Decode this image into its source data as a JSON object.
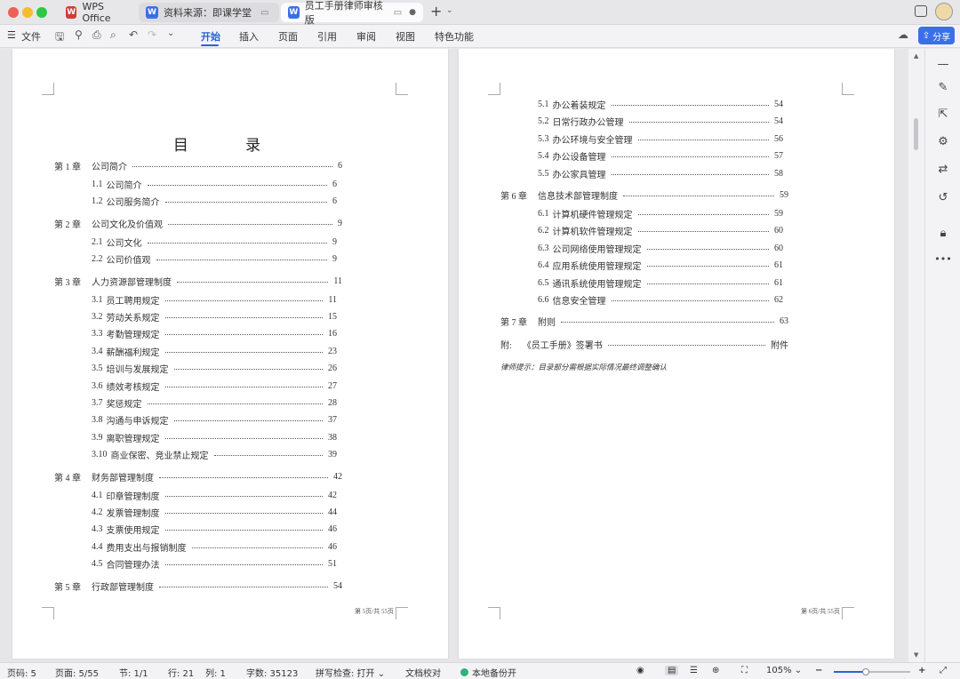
{
  "window": {
    "tabs": [
      {
        "label": "WPS Office",
        "icon": "wps-logo-icon"
      },
      {
        "label": "资料来源：即课学堂",
        "icon": "word-doc-icon"
      },
      {
        "label": "员工手册律师审核版",
        "icon": "word-doc-icon",
        "active": true
      }
    ],
    "icon_glyph_w": "W",
    "new_tab_glyph": "+"
  },
  "menubar": {
    "file": "文件",
    "tabs": [
      "开始",
      "插入",
      "页面",
      "引用",
      "审阅",
      "视图",
      "特色功能"
    ],
    "active_tab": "开始",
    "share": "分享"
  },
  "document": {
    "toc_title": "目 录",
    "left_page": {
      "entries": [
        {
          "num": "第 1 章",
          "title": "公司简介",
          "page": "6",
          "level": 1
        },
        {
          "num": "1.1",
          "title": "公司简介",
          "page": "6",
          "level": 2
        },
        {
          "num": "1.2",
          "title": "公司服务简介",
          "page": "6",
          "level": 2
        },
        {
          "num": "第 2 章",
          "title": "公司文化及价值观",
          "page": "9",
          "level": 1
        },
        {
          "num": "2.1",
          "title": "公司文化",
          "page": "9",
          "level": 2
        },
        {
          "num": "2.2",
          "title": "公司价值观",
          "page": "9",
          "level": 2
        },
        {
          "num": "第 3 章",
          "title": "人力资源部管理制度",
          "page": "11",
          "level": 1
        },
        {
          "num": "3.1",
          "title": "员工聘用规定",
          "page": "11",
          "level": 2
        },
        {
          "num": "3.2",
          "title": "劳动关系规定",
          "page": "15",
          "level": 2
        },
        {
          "num": "3.3",
          "title": "考勤管理规定",
          "page": "16",
          "level": 2
        },
        {
          "num": "3.4",
          "title": "薪酬福利规定",
          "page": "23",
          "level": 2
        },
        {
          "num": "3.5",
          "title": "培训与发展规定",
          "page": "26",
          "level": 2
        },
        {
          "num": "3.6",
          "title": "绩效考核规定",
          "page": "27",
          "level": 2
        },
        {
          "num": "3.7",
          "title": "奖惩规定",
          "page": "28",
          "level": 2
        },
        {
          "num": "3.8",
          "title": "沟通与申诉规定",
          "page": "37",
          "level": 2
        },
        {
          "num": "3.9",
          "title": "离职管理规定",
          "page": "38",
          "level": 2
        },
        {
          "num": "3.10",
          "title": "商业保密、竞业禁止规定",
          "page": "39",
          "level": 2
        },
        {
          "num": "第 4 章",
          "title": "财务部管理制度",
          "page": "42",
          "level": 1
        },
        {
          "num": "4.1",
          "title": "印章管理制度",
          "page": "42",
          "level": 2
        },
        {
          "num": "4.2",
          "title": "发票管理制度",
          "page": "44",
          "level": 2
        },
        {
          "num": "4.3",
          "title": "支票使用规定",
          "page": "46",
          "level": 2
        },
        {
          "num": "4.4",
          "title": "费用支出与报销制度",
          "page": "46",
          "level": 2
        },
        {
          "num": "4.5",
          "title": "合同管理办法",
          "page": "51",
          "level": 2
        },
        {
          "num": "第 5 章",
          "title": "行政部管理制度",
          "page": "54",
          "level": 1
        }
      ],
      "footer": "第 5页/共 55页"
    },
    "right_page": {
      "entries": [
        {
          "num": "5.1",
          "title": "办公着装规定",
          "page": "54",
          "level": 2
        },
        {
          "num": "5.2",
          "title": "日常行政办公管理",
          "page": "54",
          "level": 2
        },
        {
          "num": "5.3",
          "title": "办公环境与安全管理",
          "page": "56",
          "level": 2
        },
        {
          "num": "5.4",
          "title": "办公设备管理",
          "page": "57",
          "level": 2
        },
        {
          "num": "5.5",
          "title": "办公家具管理",
          "page": "58",
          "level": 2
        },
        {
          "num": "第 6 章",
          "title": "信息技术部管理制度",
          "page": "59",
          "level": 1
        },
        {
          "num": "6.1",
          "title": "计算机硬件管理规定",
          "page": "59",
          "level": 2
        },
        {
          "num": "6.2",
          "title": "计算机软件管理规定",
          "page": "60",
          "level": 2
        },
        {
          "num": "6.3",
          "title": "公司网络使用管理规定",
          "page": "60",
          "level": 2
        },
        {
          "num": "6.4",
          "title": "应用系统使用管理规定",
          "page": "61",
          "level": 2
        },
        {
          "num": "6.5",
          "title": "通讯系统使用管理规定",
          "page": "61",
          "level": 2
        },
        {
          "num": "6.6",
          "title": "信息安全管理",
          "page": "62",
          "level": 2
        },
        {
          "num": "第 7 章",
          "title": "附则",
          "page": "63",
          "level": 1
        },
        {
          "num": "附:",
          "title": "《员工手册》签署书",
          "page": "附件",
          "level": 1
        }
      ],
      "note": "律师提示：目录部分需根据实际情况最终调整确认",
      "footer": "第 6页/共 55页"
    }
  },
  "statusbar": {
    "page_num": "页码: 5",
    "pages": "页面: 5/55",
    "section": "节: 1/1",
    "line": "行: 21",
    "col": "列: 1",
    "words": "字数: 35123",
    "spell": "拼写检查: 打开",
    "proof": "文档校对",
    "backup": "本地备份开",
    "zoom": "105%",
    "zoom_level": 0.42
  },
  "colors": {
    "accent": "#2a62d9",
    "share_bg": "#3b6fea",
    "wps_red": "#d93a35",
    "word_blue": "#3b6fea",
    "backup_green": "#2db37a"
  }
}
